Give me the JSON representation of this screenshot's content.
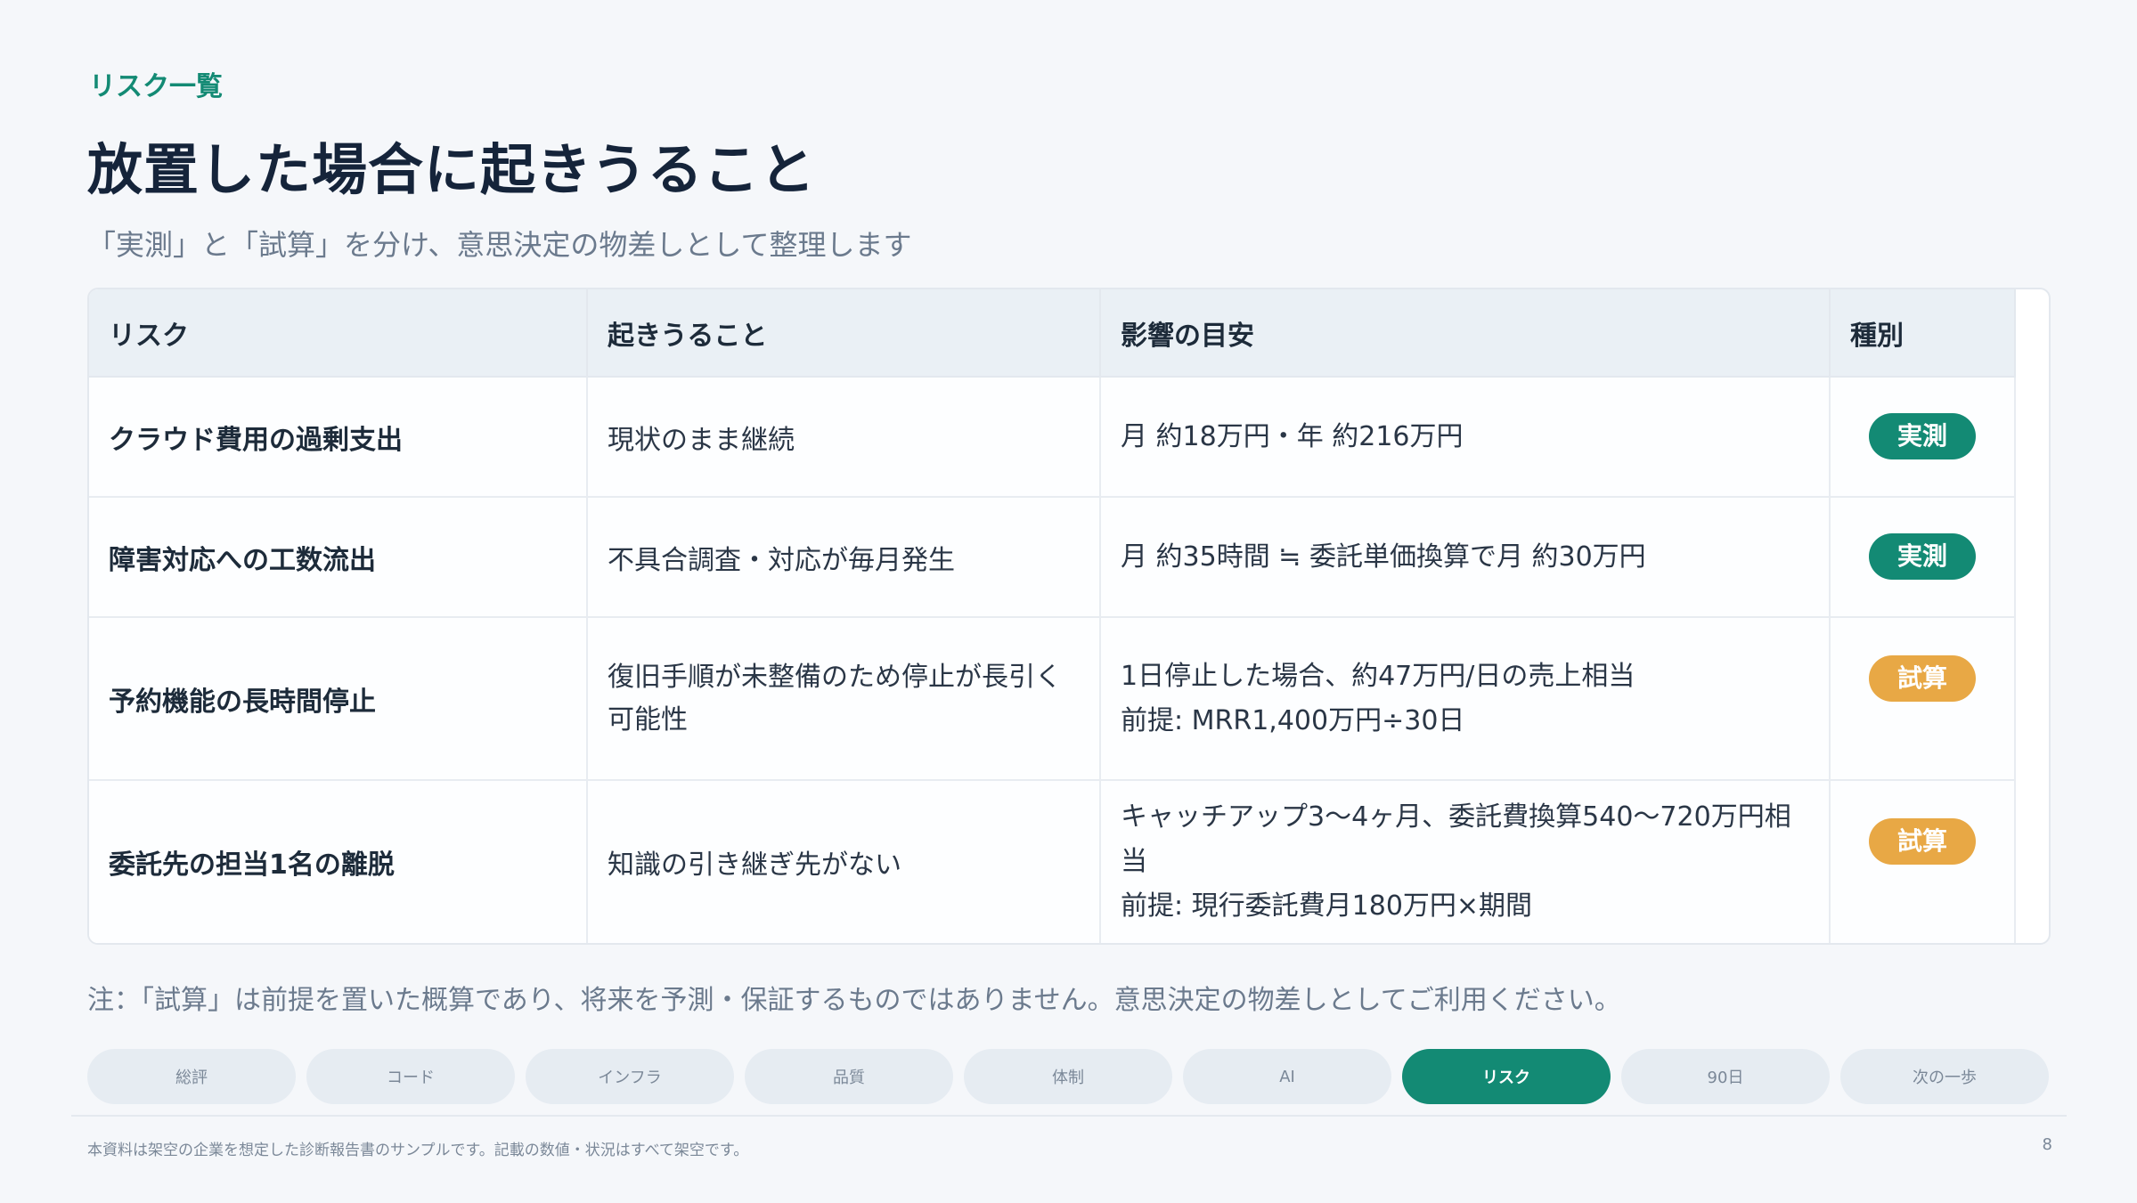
{
  "header": {
    "eyebrow": "リスク一覧",
    "title": "放置した場合に起きうること",
    "subtitle": "「実測」と「試算」を分け、意思決定の物差しとして整理します"
  },
  "table": {
    "columns": [
      "リスク",
      "起きうること",
      "影響の目安",
      "種別"
    ],
    "rows": [
      {
        "risk": "クラウド費用の過剰支出",
        "occurrence": [
          "現状のまま継続"
        ],
        "impact": [
          "月 約18万円・年 約216万円"
        ],
        "type": "実測",
        "type_kind": "measured"
      },
      {
        "risk": "障害対応への工数流出",
        "occurrence": [
          "不具合調査・対応が毎月発生"
        ],
        "impact": [
          "月 約35時間 ≒ 委託単価換算で月 約30万円"
        ],
        "type": "実測",
        "type_kind": "measured"
      },
      {
        "risk": "予約機能の長時間停止",
        "occurrence": [
          "復旧手順が未整備のため停止が長引く",
          "可能性"
        ],
        "impact": [
          "1日停止した場合、約47万円/日の売上相当",
          "前提: MRR1,400万円÷30日"
        ],
        "type": "試算",
        "type_kind": "estimate"
      },
      {
        "risk": "委託先の担当1名の離脱",
        "occurrence": [
          "知識の引き継ぎ先がない"
        ],
        "impact": [
          "キャッチアップ3〜4ヶ月、委託費換算540〜720万円相当",
          "前提: 現行委託費月180万円×期間"
        ],
        "type": "試算",
        "type_kind": "estimate"
      }
    ]
  },
  "note": "注：「試算」は前提を置いた概算であり、将来を予測・保証するものではありません。意思決定の物差しとしてご利用ください。",
  "nav": {
    "items": [
      "総評",
      "コード",
      "インフラ",
      "品質",
      "体制",
      "AI",
      "リスク",
      "90日",
      "次の一歩"
    ],
    "active_index": 6
  },
  "footer": {
    "disclaimer": "本資料は架空の企業を想定した診断報告書のサンプルです。記載の数値・状況はすべて架空です。",
    "page_number": "8"
  },
  "colors": {
    "accent": "#138a74",
    "estimate": "#e8a845"
  }
}
